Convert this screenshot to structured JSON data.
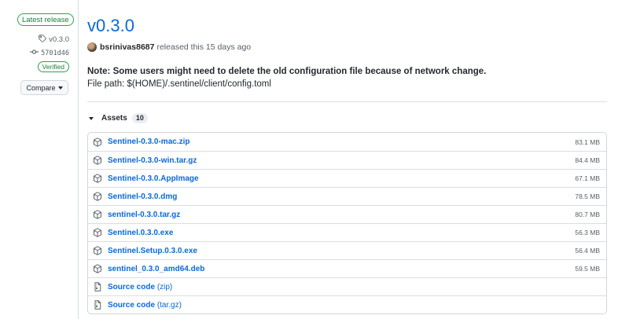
{
  "sidebar": {
    "badge": "Latest release",
    "tag": "v0.3.0",
    "commit": "5701d46",
    "verified": "Verified",
    "compare": "Compare"
  },
  "release": {
    "title": "v0.3.0",
    "author": "bsrinivas8687",
    "released_text": "released this 15 days ago",
    "note": "Note: Some users might need to delete the old configuration file because of network change.",
    "filepath": "File path: $(HOME)/.sentinel/client/config.toml"
  },
  "assets": {
    "label": "Assets",
    "count": "10",
    "files": [
      {
        "name": "Sentinel-0.3.0-mac.zip",
        "size": "83.1 MB"
      },
      {
        "name": "Sentinel-0.3.0-win.tar.gz",
        "size": "84.4 MB"
      },
      {
        "name": "Sentinel-0.3.0.AppImage",
        "size": "67.1 MB"
      },
      {
        "name": "Sentinel-0.3.0.dmg",
        "size": "78.5 MB"
      },
      {
        "name": "sentinel-0.3.0.tar.gz",
        "size": "80.7 MB"
      },
      {
        "name": "Sentinel.0.3.0.exe",
        "size": "56.3 MB"
      },
      {
        "name": "Sentinel.Setup.0.3.0.exe",
        "size": "56.4 MB"
      },
      {
        "name": "sentinel_0.3.0_amd64.deb",
        "size": "59.5 MB"
      }
    ],
    "source": [
      {
        "name": "Source code",
        "suffix": "(zip)"
      },
      {
        "name": "Source code",
        "suffix": "(tar.gz)"
      }
    ]
  }
}
